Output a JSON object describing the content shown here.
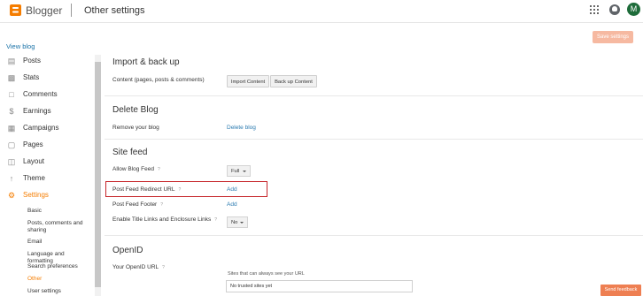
{
  "header": {
    "brand": "Blogger",
    "page_title": "Other settings",
    "avatar_letter": "M"
  },
  "toolbar": {
    "save_label": "Save settings"
  },
  "sidebar": {
    "view_blog": "View blog",
    "items": [
      {
        "label": "Posts",
        "icon": "posts-icon"
      },
      {
        "label": "Stats",
        "icon": "stats-icon"
      },
      {
        "label": "Comments",
        "icon": "comments-icon"
      },
      {
        "label": "Earnings",
        "icon": "dollar-icon"
      },
      {
        "label": "Campaigns",
        "icon": "campaigns-icon"
      },
      {
        "label": "Pages",
        "icon": "pages-icon"
      },
      {
        "label": "Layout",
        "icon": "layout-icon"
      },
      {
        "label": "Theme",
        "icon": "theme-icon"
      },
      {
        "label": "Settings",
        "icon": "gear-icon",
        "active": true
      }
    ],
    "sub_items": [
      {
        "label": "Basic"
      },
      {
        "label": "Posts, comments and sharing"
      },
      {
        "label": "Email"
      },
      {
        "label": "Language and formatting"
      },
      {
        "label": "Search preferences"
      },
      {
        "label": "Other",
        "active": true
      },
      {
        "label": "User settings"
      }
    ]
  },
  "main": {
    "import_backup": {
      "title": "Import & back up",
      "row_label": "Content (pages, posts & comments)",
      "import_label": "Import Content",
      "backup_label": "Back up Content"
    },
    "delete_blog": {
      "title": "Delete Blog",
      "row_label": "Remove your blog",
      "link": "Delete blog"
    },
    "site_feed": {
      "title": "Site feed",
      "allow_label": "Allow Blog Feed",
      "allow_value": "Full",
      "redirect_label": "Post Feed Redirect URL",
      "redirect_link": "Add",
      "footer_label": "Post Feed Footer",
      "footer_link": "Add",
      "enclosure_label": "Enable Title Links and Enclosure Links",
      "enclosure_value": "No"
    },
    "openid": {
      "title": "OpenID",
      "url_label": "Your OpenID URL",
      "trusted_label": "Sites that can always see your URL",
      "trusted_value": "No trusted sites yet"
    }
  },
  "feedback": {
    "label": "Send feedback"
  },
  "help_glyph": "?"
}
